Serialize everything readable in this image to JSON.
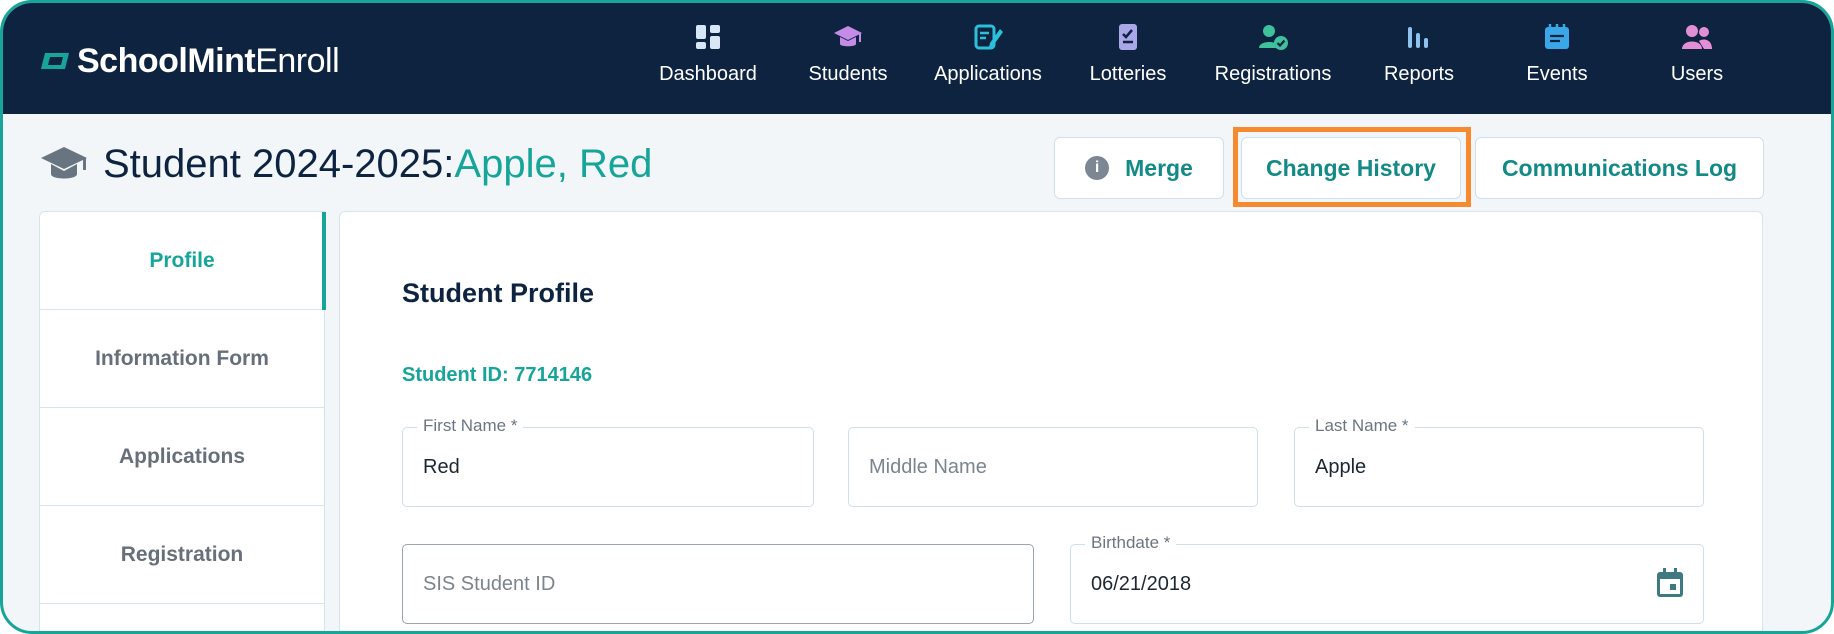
{
  "brand": {
    "bold": "SchoolMint",
    "light": "Enroll"
  },
  "nav": [
    {
      "label": "Dashboard",
      "icon": "dashboard-icon",
      "color": "#d9e6f5"
    },
    {
      "label": "Students",
      "icon": "graduation-cap-icon",
      "color": "#c58be8"
    },
    {
      "label": "Applications",
      "icon": "application-edit-icon",
      "color": "#2bbfd9"
    },
    {
      "label": "Lotteries",
      "icon": "lottery-ticket-icon",
      "color": "#a9a7e8"
    },
    {
      "label": "Registrations",
      "icon": "registration-user-check-icon",
      "color": "#3fc19b"
    },
    {
      "label": "Reports",
      "icon": "reports-bars-icon",
      "color": "#8fc3ef"
    },
    {
      "label": "Events",
      "icon": "events-notepad-icon",
      "color": "#3aa8e8"
    },
    {
      "label": "Users",
      "icon": "users-icon",
      "color": "#e38fd8"
    }
  ],
  "page": {
    "title_prefix": "Student 2024-2025:",
    "student_name": "Apple, Red"
  },
  "actions": {
    "merge": "Merge",
    "change_history": "Change History",
    "communications_log": "Communications Log"
  },
  "sidebar": {
    "items": [
      {
        "label": "Profile",
        "active": true
      },
      {
        "label": "Information Form",
        "active": false
      },
      {
        "label": "Applications",
        "active": false
      },
      {
        "label": "Registration",
        "active": false
      }
    ]
  },
  "profile": {
    "heading": "Student Profile",
    "student_id": "Student ID: 7714146",
    "first_name": {
      "label": "First Name *",
      "value": "Red"
    },
    "middle_name": {
      "placeholder": "Middle Name"
    },
    "last_name": {
      "label": "Last Name *",
      "value": "Apple"
    },
    "sis_id": {
      "placeholder": "SIS Student ID"
    },
    "birthdate": {
      "label": "Birthdate *",
      "value": "06/21/2018"
    }
  },
  "colors": {
    "navy": "#0e2340",
    "teal": "#17a59a",
    "highlight": "#f7892e"
  }
}
